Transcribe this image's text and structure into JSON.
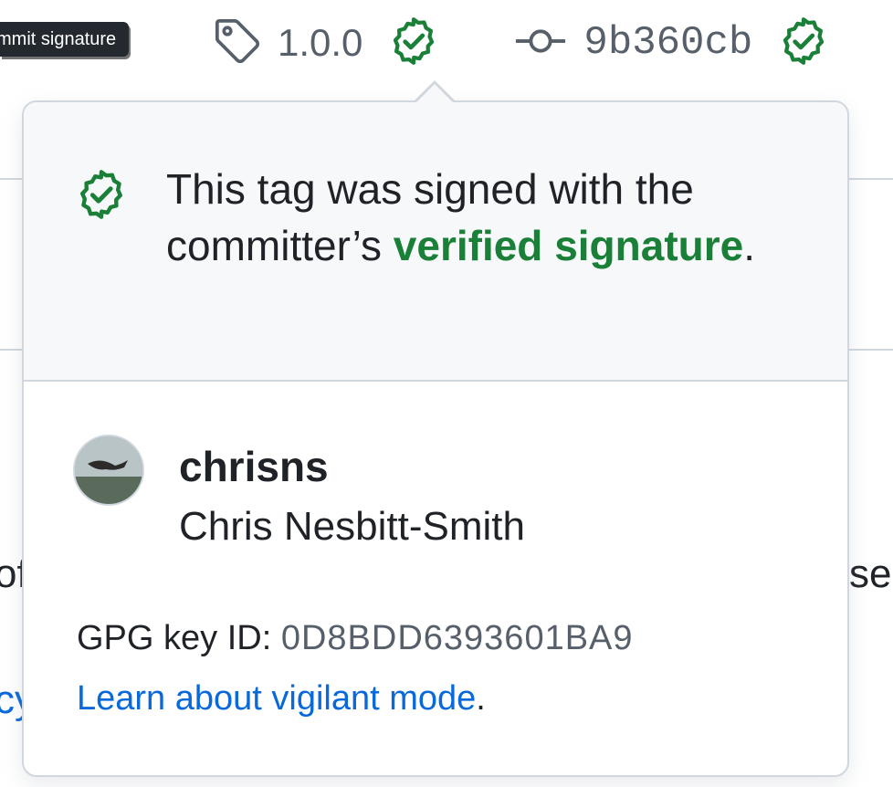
{
  "tooltip": {
    "text": "mmit signature"
  },
  "header": {
    "tag_label": "1.0.0",
    "commit_sha": "9b360cb",
    "verified_color": "#1a7f37"
  },
  "background": {
    "fragment_left_1": "of",
    "fragment_right_1": "se",
    "fragment_left_2": "cy"
  },
  "popover": {
    "message_prefix": "This tag was signed with the committer’s ",
    "message_link": "verified signature",
    "message_suffix": ".",
    "user": {
      "login": "chrisns",
      "name": "Chris Nesbitt-Smith"
    },
    "gpg_label": "GPG key ID: ",
    "gpg_key": "0D8BDD6393601BA9",
    "learn_link": "Learn about vigilant mode",
    "learn_suffix": "."
  },
  "icons": {
    "tag": "tag-icon",
    "verified": "verified-badge-icon",
    "commit": "git-commit-icon"
  }
}
